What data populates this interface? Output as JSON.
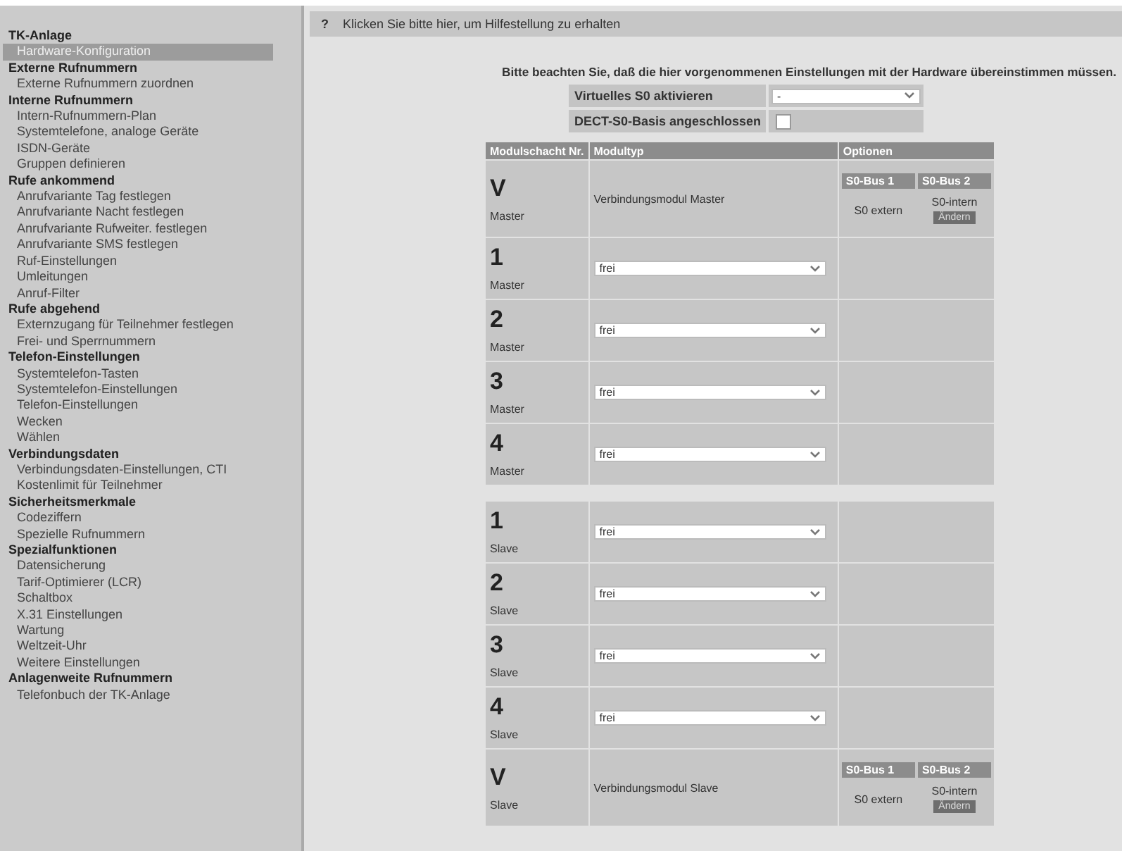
{
  "sidebar": {
    "sections": [
      {
        "title": "TK-Anlage",
        "items": [
          {
            "label": "Hardware-Konfiguration",
            "selected": true
          }
        ]
      },
      {
        "title": "Externe Rufnummern",
        "items": [
          {
            "label": "Externe Rufnummern zuordnen",
            "selected": false
          }
        ]
      },
      {
        "title": "Interne Rufnummern",
        "items": [
          {
            "label": "Intern-Rufnummern-Plan",
            "selected": false
          },
          {
            "label": "Systemtelefone, analoge Geräte",
            "selected": false
          },
          {
            "label": "ISDN-Geräte",
            "selected": false
          },
          {
            "label": "Gruppen definieren",
            "selected": false
          }
        ]
      },
      {
        "title": "Rufe ankommend",
        "items": [
          {
            "label": "Anrufvariante Tag festlegen",
            "selected": false
          },
          {
            "label": "Anrufvariante Nacht festlegen",
            "selected": false
          },
          {
            "label": "Anrufvariante Rufweiter. festlegen",
            "selected": false
          },
          {
            "label": "Anrufvariante SMS festlegen",
            "selected": false
          },
          {
            "label": "Ruf-Einstellungen",
            "selected": false
          },
          {
            "label": "Umleitungen",
            "selected": false
          },
          {
            "label": "Anruf-Filter",
            "selected": false
          }
        ]
      },
      {
        "title": "Rufe abgehend",
        "items": [
          {
            "label": "Externzugang für Teilnehmer festlegen",
            "selected": false
          },
          {
            "label": "Frei- und Sperrnummern",
            "selected": false
          }
        ]
      },
      {
        "title": "Telefon-Einstellungen",
        "items": [
          {
            "label": "Systemtelefon-Tasten",
            "selected": false
          },
          {
            "label": "Systemtelefon-Einstellungen",
            "selected": false
          },
          {
            "label": "Telefon-Einstellungen",
            "selected": false
          },
          {
            "label": "Wecken",
            "selected": false
          },
          {
            "label": "Wählen",
            "selected": false
          }
        ]
      },
      {
        "title": "Verbindungsdaten",
        "items": [
          {
            "label": "Verbindungsdaten-Einstellungen, CTI",
            "selected": false
          },
          {
            "label": "Kostenlimit für Teilnehmer",
            "selected": false
          }
        ]
      },
      {
        "title": "Sicherheitsmerkmale",
        "items": [
          {
            "label": "Codeziffern",
            "selected": false
          },
          {
            "label": "Spezielle Rufnummern",
            "selected": false
          }
        ]
      },
      {
        "title": "Spezialfunktionen",
        "items": [
          {
            "label": "Datensicherung",
            "selected": false
          },
          {
            "label": "Tarif-Optimierer (LCR)",
            "selected": false
          },
          {
            "label": "Schaltbox",
            "selected": false
          },
          {
            "label": "X.31 Einstellungen",
            "selected": false
          },
          {
            "label": "Wartung",
            "selected": false
          },
          {
            "label": "Weltzeit-Uhr",
            "selected": false
          },
          {
            "label": "Weitere Einstellungen",
            "selected": false
          }
        ]
      },
      {
        "title": "Anlagenweite Rufnummern",
        "items": [
          {
            "label": "Telefonbuch der TK-Anlage",
            "selected": false
          }
        ]
      }
    ]
  },
  "help_bar": {
    "icon": "?",
    "text": "Klicken Sie bitte hier, um Hilfestellung zu erhalten"
  },
  "notice": "Bitte beachten Sie, daß die hier vorgenommenen Einstellungen mit der Hardware übereinstimmen müssen.",
  "settings": [
    {
      "kind": "select",
      "label": "Virtuelles S0 aktivieren",
      "value": "-"
    },
    {
      "kind": "checkbox",
      "label": "DECT-S0-Basis angeschlossen",
      "checked": false
    }
  ],
  "table": {
    "columns": [
      "Modulschacht Nr.",
      "Modultyp",
      "Optionen"
    ],
    "groups": [
      {
        "rows": [
          {
            "kind": "module",
            "slot": "V",
            "role": "Master",
            "module": "Verbindungsmodul Master",
            "options": {
              "columns": [
                "S0-Bus 1",
                "S0-Bus 2"
              ],
              "bus_1": "S0 extern",
              "bus_2": "S0-intern",
              "button": "Ändern"
            }
          },
          {
            "kind": "select",
            "slot": "1",
            "role": "Master",
            "value": "frei"
          },
          {
            "kind": "select",
            "slot": "2",
            "role": "Master",
            "value": "frei"
          },
          {
            "kind": "select",
            "slot": "3",
            "role": "Master",
            "value": "frei"
          },
          {
            "kind": "select",
            "slot": "4",
            "role": "Master",
            "value": "frei"
          }
        ]
      },
      {
        "rows": [
          {
            "kind": "select",
            "slot": "1",
            "role": "Slave",
            "value": "frei"
          },
          {
            "kind": "select",
            "slot": "2",
            "role": "Slave",
            "value": "frei"
          },
          {
            "kind": "select",
            "slot": "3",
            "role": "Slave",
            "value": "frei"
          },
          {
            "kind": "select",
            "slot": "4",
            "role": "Slave",
            "value": "frei"
          },
          {
            "kind": "module",
            "slot": "V",
            "role": "Slave",
            "module": "Verbindungsmodul Slave",
            "options": {
              "columns": [
                "S0-Bus 1",
                "S0-Bus 2"
              ],
              "bus_1": "S0 extern",
              "bus_2": "S0-intern",
              "button": "Ändern"
            }
          }
        ]
      }
    ]
  }
}
